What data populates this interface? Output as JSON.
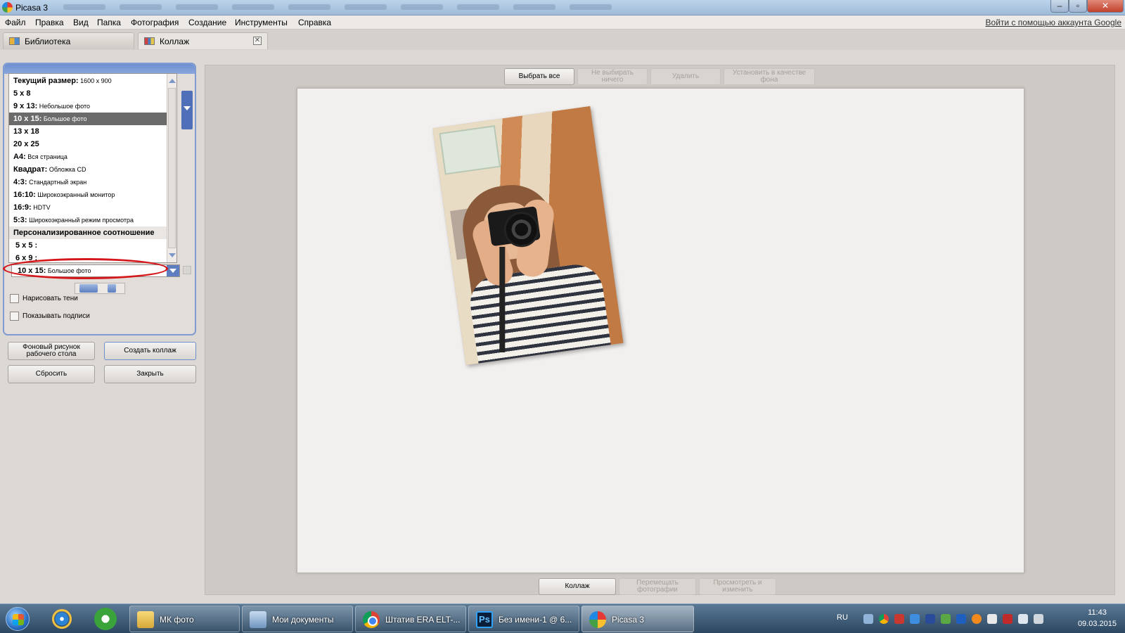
{
  "window": {
    "title": "Picasa 3",
    "controls": {
      "minimize": "–",
      "maximize": "▫",
      "close": "✕"
    }
  },
  "menu": {
    "items": [
      "Файл",
      "Правка",
      "Вид",
      "Папка",
      "Фотография",
      "Создание",
      "Инструменты",
      "Справка"
    ],
    "signin": "Войти с помощью аккаунта Google"
  },
  "tabs": [
    {
      "label": "Библиотека",
      "icon": "library-icon"
    },
    {
      "label": "Коллаж",
      "icon": "collage-icon",
      "close": "✕"
    }
  ],
  "size_list": {
    "items": [
      {
        "bold": "Текущий размер:",
        "small": " 1600 x 900"
      },
      {
        "bold": "5 x 8",
        "small": ""
      },
      {
        "bold": "9 x 13:",
        "small": " Небольшое фото"
      },
      {
        "bold": "10 x 15:",
        "small": " Большое фото"
      },
      {
        "bold": "13 x 18",
        "small": ""
      },
      {
        "bold": "20 x 25",
        "small": ""
      },
      {
        "bold": "A4:",
        "small": " Вся страница"
      },
      {
        "bold": "Квадрат:",
        "small": " Обложка CD"
      },
      {
        "bold": "4:3:",
        "small": " Стандартный экран"
      },
      {
        "bold": "16:10:",
        "small": " Широкоэкранный монитор"
      },
      {
        "bold": "16:9:",
        "small": " HDTV"
      },
      {
        "bold": "5:3:",
        "small": " Широкоэкранный режим просмотра"
      },
      {
        "bold": "Персонализированное соотношение",
        "small": ""
      },
      {
        "bold": "5 x 5 :",
        "small": ""
      },
      {
        "bold": "6 x 9 :",
        "small": ""
      }
    ],
    "selected_index": 3
  },
  "dropdown": {
    "bold": "10 x 15:",
    "small": " Большое фото"
  },
  "options": {
    "draw_shadows": "Нарисовать тени",
    "show_captions": "Показывать подписи"
  },
  "buttons": {
    "desktop_background": "Фоновый рисунок рабочего стола",
    "create_collage": "Создать коллаж",
    "reset": "Сбросить",
    "close": "Закрыть"
  },
  "top_toolbar": {
    "select_all": "Выбрать все",
    "select_none": "Не выбирать ничего",
    "delete": "Удалить",
    "set_background": "Установить в качестве фона"
  },
  "bottom_toolbar": {
    "collage": "Коллаж",
    "move_photos": "Перемещать фотографии",
    "view_edit": "Просмотреть и изменить"
  },
  "taskbar": {
    "tasks": [
      {
        "label": "МК фото",
        "icon": "folder-icon"
      },
      {
        "label": "Мои документы",
        "icon": "documents-icon"
      },
      {
        "label": "Штатив ERA ELT-...",
        "icon": "chrome-icon"
      },
      {
        "label": "Без имени-1 @ 6...",
        "icon": "photoshop-icon",
        "badge": "Ps"
      },
      {
        "label": "Picasa 3",
        "icon": "picasa-icon"
      }
    ],
    "lang": "RU",
    "time": "11:43",
    "date": "09.03.2015"
  },
  "colors": {
    "accent_blue": "#5e7ec0",
    "highlight_red": "#d4181c",
    "selected_row": "#6b6b6b"
  }
}
